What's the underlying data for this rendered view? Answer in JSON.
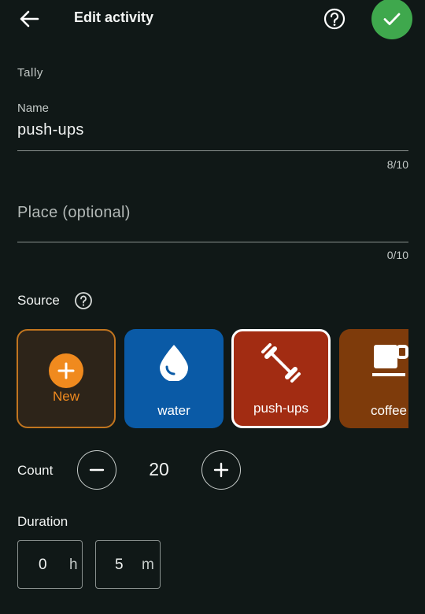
{
  "header": {
    "title": "Edit activity",
    "icons": {
      "back": "arrow-left-icon",
      "help": "help-circle-icon",
      "save": "check-icon"
    },
    "save_color": "#3fa84d"
  },
  "section_caption": "Tally",
  "name_field": {
    "label": "Name",
    "value": "push-ups",
    "counter": "8/10"
  },
  "place_field": {
    "placeholder": "Place (optional)",
    "value": "",
    "counter": "0/10"
  },
  "source": {
    "label": "Source",
    "help_icon": "help-circle-icon",
    "cards": [
      {
        "label": "New",
        "icon": "plus-circle-icon",
        "color": "#2d2419",
        "accent": "#f08a1e"
      },
      {
        "label": "water",
        "icon": "water-drop-icon",
        "color": "#0a5aa6"
      },
      {
        "label": "push-ups",
        "icon": "dumbbell-icon",
        "color": "#a22c12",
        "selected": true
      },
      {
        "label": "coffee",
        "icon": "coffee-cup-icon",
        "color": "#7e3b0b"
      }
    ]
  },
  "count": {
    "label": "Count",
    "value": "20",
    "minus_icon": "minus-icon",
    "plus_icon": "plus-icon"
  },
  "duration": {
    "label": "Duration",
    "hours": {
      "value": "0",
      "unit": "h"
    },
    "minutes": {
      "value": "5",
      "unit": "m"
    }
  }
}
